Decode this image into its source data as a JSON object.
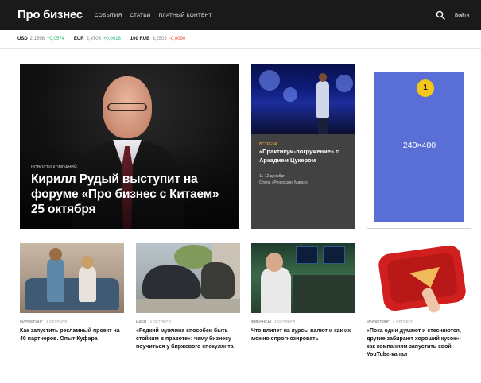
{
  "header": {
    "logo": "Про бизнес",
    "nav": [
      "СОБЫТИЯ",
      "СТАТЬИ",
      "ПЛАТНЫЙ КОНТЕНТ"
    ],
    "login": "Войти",
    "search_icon": "search-icon"
  },
  "ticker": [
    {
      "cur": "USD",
      "val": "2,1598",
      "chg": "+0,0574",
      "dir": "up"
    },
    {
      "cur": "EUR",
      "val": "2,4708",
      "chg": "+0,0016",
      "dir": "up"
    },
    {
      "cur": "100 RUB",
      "val": "3,2502",
      "chg": "-0,0090",
      "dir": "down"
    }
  ],
  "hero": {
    "category": "НОВОСТИ КОМПАНИЙ",
    "title": "Кирилл Рудый выступит на форуме «Про бизнес с Китаем» 25 октября"
  },
  "event": {
    "category": "ВСТРЕЧА",
    "title": "«Практикум-погружение» с Аркадием Цукером",
    "date": "11-12 декабря",
    "place": "Отель «Ренессанс Минск»",
    "active_slide": 3,
    "slide_count": 4
  },
  "ad": {
    "badge": "1",
    "label": "240×400"
  },
  "cards": [
    {
      "category": "МАРКЕТИНГ",
      "date": "3 октября",
      "title": "Как запустить рекламный проект на 40 партнеров. Опыт Куфара"
    },
    {
      "category": "ИДЕИ",
      "date": "4 октября",
      "title": "«Редкий мужчина способен быть стойким в правоте»: чему бизнесу поучиться у биржевого спекулянта"
    },
    {
      "category": "ФИНАНСЫ",
      "date": "4 октября",
      "title": "Что влияет на курсы валют и как их можно спрогнозировать"
    },
    {
      "category": "МАРКЕТИНГ",
      "date": "4 октября",
      "title": "«Пока одни думают и стесняются, другие забирают хороший кусок»: как компаниям запустить свой YouTube-канал"
    }
  ],
  "colors": {
    "header_bg": "#1a1a1a",
    "up": "#2bb673",
    "down": "#e64b3b",
    "event_accent": "#f0b43a",
    "ad_bg": "#5a6fd6",
    "badge": "#f5c518"
  }
}
